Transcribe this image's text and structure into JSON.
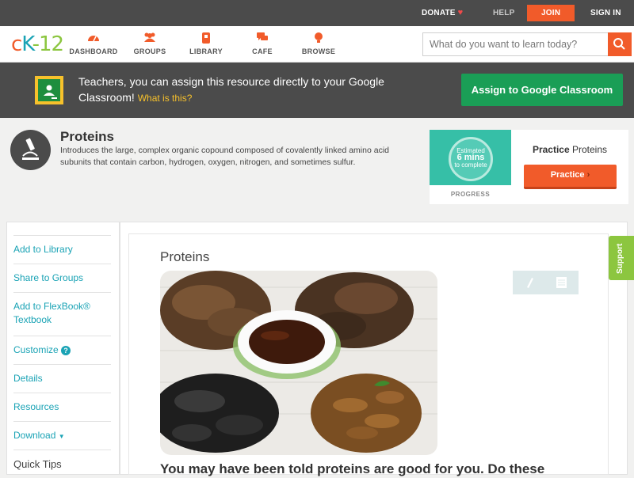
{
  "topbar": {
    "donate_label": "DONATE",
    "heart_glyph": "♥",
    "help_label": "HELP",
    "join_label": "JOIN",
    "signin_label": "SIGN IN"
  },
  "nav": {
    "logo": {
      "c": "c",
      "k": "K",
      "rest": "12"
    },
    "items": [
      {
        "label": "DASHBOARD",
        "icon": "dashboard-icon"
      },
      {
        "label": "GROUPS",
        "icon": "groups-icon"
      },
      {
        "label": "LIBRARY",
        "icon": "library-icon"
      },
      {
        "label": "CAFE",
        "icon": "cafe-icon"
      },
      {
        "label": "BROWSE",
        "icon": "browse-icon"
      }
    ],
    "search_placeholder": "What do you want to learn today?"
  },
  "banner": {
    "text": "Teachers, you can assign this resource directly to your Google Classroom!",
    "link": "What is this?",
    "assign_button": "Assign to Google Classroom"
  },
  "module": {
    "title": "Proteins",
    "description": "Introduces the large, complex organic copound composed of covalently linked amino acid subunits that contain carbon, hydrogen, oxygen, nitrogen, and sometimes sulfur."
  },
  "practice": {
    "estimated_line1": "Estimated",
    "estimated_line2": "6 mins",
    "estimated_line3": "to complete",
    "progress_label": "PROGRESS",
    "title_bold": "Practice",
    "title_rest": "Proteins",
    "button_label": "Practice"
  },
  "sidebar": {
    "items": [
      {
        "label": "Add to Library"
      },
      {
        "label": "Share to Groups"
      },
      {
        "label": "Add to FlexBook® Textbook"
      },
      {
        "label": "Customize"
      },
      {
        "label": "Details"
      },
      {
        "label": "Resources"
      },
      {
        "label": "Download"
      },
      {
        "label": "Quick Tips"
      }
    ]
  },
  "content": {
    "title": "Proteins",
    "intro": "You may have been told proteins are good for you. Do these"
  },
  "support_label": "Support",
  "colors": {
    "accent_orange": "#f15b2a",
    "teal": "#1aa3b5",
    "green_button": "#1a9e56",
    "dark_bar": "#4b4b4b",
    "support_green": "#8cc63f"
  }
}
